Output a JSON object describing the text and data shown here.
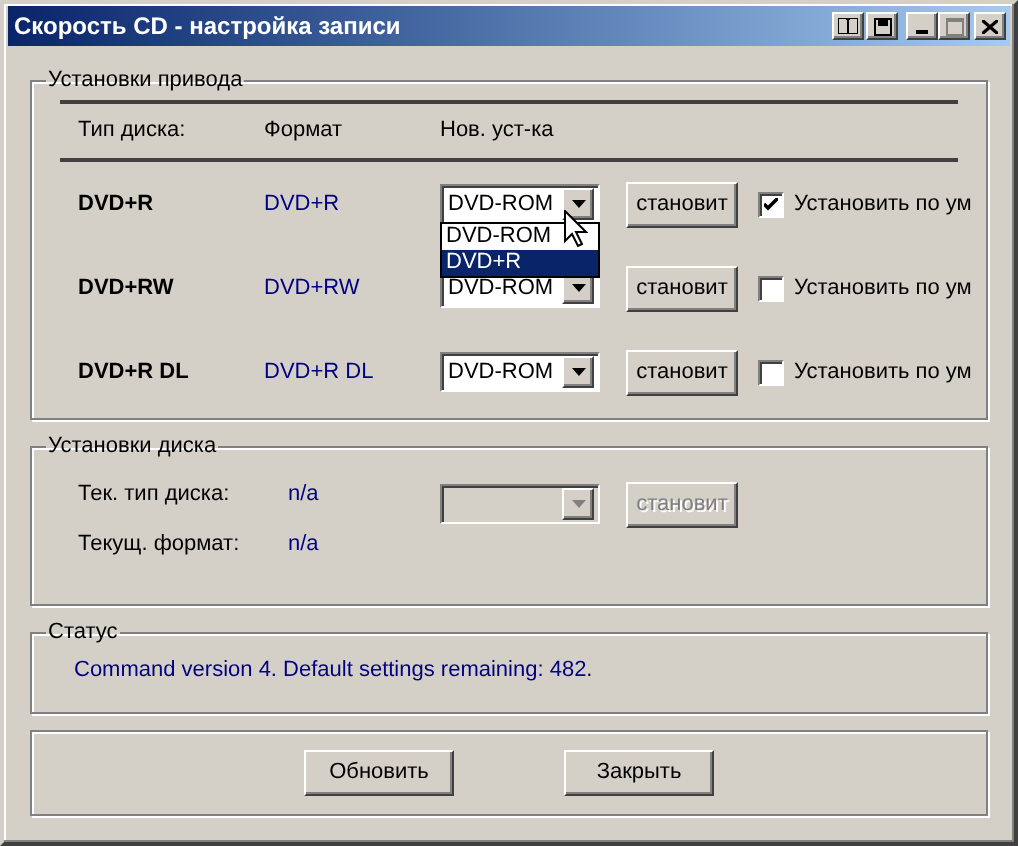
{
  "window": {
    "title": "Скорость CD - настройка записи"
  },
  "drive_settings": {
    "title": "Установки привода",
    "columns": [
      "Тип диска:",
      "Формат",
      "Нов. уст-ка"
    ],
    "rows": [
      {
        "disc_type": "DVD+R",
        "format": "DVD+R",
        "new_setting": "DVD-ROM",
        "set_button": "становит",
        "default_checkbox": {
          "label": "Установить по ум",
          "checked": true
        },
        "open_list": [
          {
            "label": "DVD-ROM",
            "selected": false
          },
          {
            "label": "DVD+R",
            "selected": true
          }
        ]
      },
      {
        "disc_type": "DVD+RW",
        "format": "DVD+RW",
        "new_setting": "DVD-ROM",
        "set_button": "становит",
        "default_checkbox": {
          "label": "Установить по ум",
          "checked": false
        }
      },
      {
        "disc_type": "DVD+R DL",
        "format": "DVD+R DL",
        "new_setting": "DVD-ROM",
        "set_button": "становит",
        "default_checkbox": {
          "label": "Установить по ум",
          "checked": false
        }
      }
    ]
  },
  "disc_settings": {
    "title": "Установки диска",
    "fields": [
      {
        "label": "Тек. тип диска:",
        "value": "n/a"
      },
      {
        "label": "Текущ. формат:",
        "value": "n/a"
      }
    ],
    "combo": {
      "disabled": true
    },
    "set_button": {
      "label": "становит",
      "disabled": true
    }
  },
  "status": {
    "title": "Статус",
    "message": "Command version 4. Default settings remaining: 482."
  },
  "buttons": [
    "Обновить",
    "Закрыть"
  ]
}
